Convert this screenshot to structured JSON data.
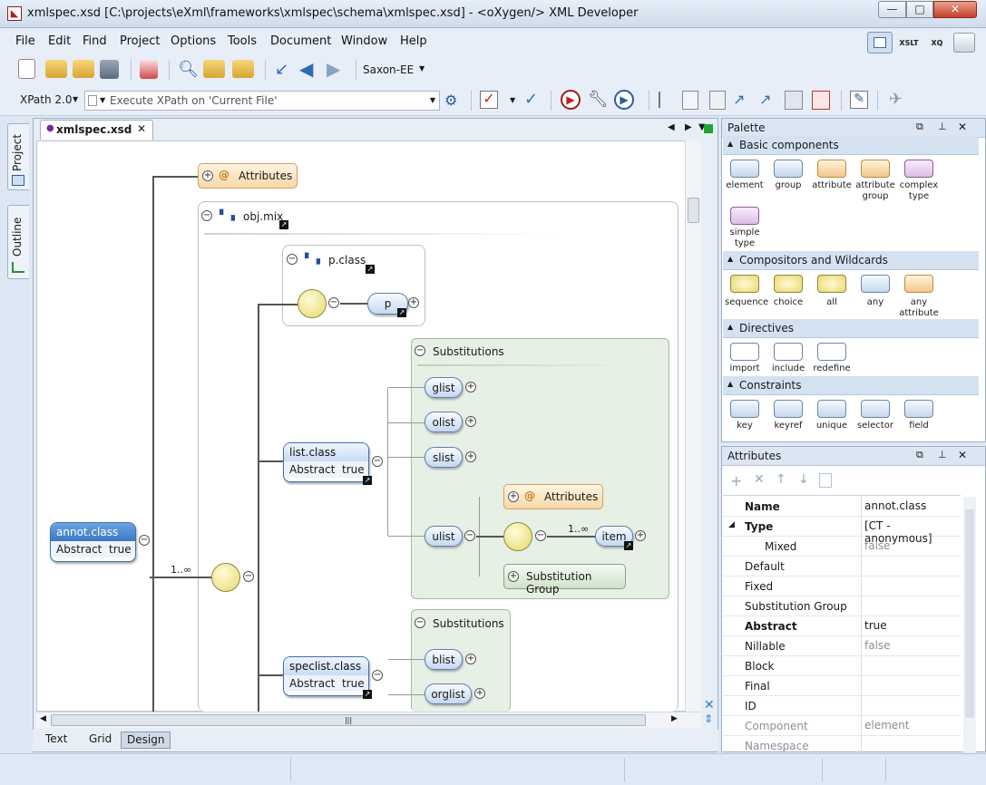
{
  "window": {
    "title": "xmlspec.xsd [C:\\projects\\eXml\\frameworks\\xmlspec\\schema\\xmlspec.xsd] - <oXygen/> XML Developer",
    "minimize": "—",
    "maximize": "□",
    "close": "✕"
  },
  "menu": [
    "File",
    "Edit",
    "Find",
    "Project",
    "Options",
    "Tools",
    "Document",
    "Window",
    "Help"
  ],
  "toolbar": {
    "transformer": "Saxon-EE",
    "xpath_version": "XPath 2.0",
    "xpath_placeholder": "Execute XPath on 'Current File'",
    "badge_xslt": "XSLT",
    "badge_xq": "XQ"
  },
  "side_tabs": [
    "Project",
    "Outline"
  ],
  "editor": {
    "tab_label": "xmlspec.xsd",
    "bottom_tabs": [
      "Text",
      "Grid",
      "Design"
    ],
    "active_bottom_tab": "Design"
  },
  "diagram": {
    "attributes_top": "Attributes",
    "obj_mix": "obj.mix",
    "p_class": "p.class",
    "p": "p",
    "substitutions_1": "Substitutions",
    "glist": "glist",
    "olist": "olist",
    "slist": "slist",
    "ulist": "ulist",
    "list_class": "list.class",
    "list_class_attr": "Abstract",
    "list_class_val": "true",
    "attributes_inner": "Attributes",
    "item": "item",
    "item_card": "1..∞",
    "substitution_group": "Substitution Group",
    "annot_class": "annot.class",
    "annot_attr": "Abstract",
    "annot_val": "true",
    "main_card": "1..∞",
    "substitutions_2": "Substitutions",
    "speclist_class": "speclist.class",
    "speclist_attr": "Abstract",
    "speclist_val": "true",
    "blist": "blist",
    "orglist": "orglist"
  },
  "palette": {
    "title": "Palette",
    "sections": [
      {
        "title": "Basic components",
        "items": [
          "element",
          "group",
          "attribute",
          "attribute\ngroup",
          "complex\ntype",
          "simple\ntype"
        ]
      },
      {
        "title": "Compositors and Wildcards",
        "items": [
          "sequence",
          "choice",
          "all",
          "any",
          "any\nattribute"
        ]
      },
      {
        "title": "Directives",
        "items": [
          "import",
          "include",
          "redefine"
        ]
      },
      {
        "title": "Constraints",
        "items": [
          "key",
          "keyref",
          "unique",
          "selector",
          "field"
        ]
      }
    ]
  },
  "attributes_panel": {
    "title": "Attributes",
    "rows": [
      {
        "name": "Name",
        "value": "annot.class",
        "bold": true,
        "expand": ""
      },
      {
        "name": "Type",
        "value": "[CT - anonymous]",
        "bold": true,
        "expand": "◢"
      },
      {
        "name": "Mixed",
        "value": "false",
        "bold": false,
        "expand": "",
        "indent": true,
        "grey": true
      },
      {
        "name": "Default",
        "value": "",
        "bold": false,
        "expand": ""
      },
      {
        "name": "Fixed",
        "value": "",
        "bold": false,
        "expand": ""
      },
      {
        "name": "Substitution Group",
        "value": "",
        "bold": false,
        "expand": ""
      },
      {
        "name": "Abstract",
        "value": "true",
        "bold": true,
        "expand": ""
      },
      {
        "name": "Nillable",
        "value": "false",
        "bold": false,
        "expand": "",
        "grey": true
      },
      {
        "name": "Block",
        "value": "",
        "bold": false,
        "expand": ""
      },
      {
        "name": "Final",
        "value": "",
        "bold": false,
        "expand": ""
      },
      {
        "name": "ID",
        "value": "",
        "bold": false,
        "expand": ""
      },
      {
        "name": "Component",
        "value": "element",
        "bold": false,
        "expand": "",
        "greyname": true,
        "grey": true
      },
      {
        "name": "Namespace",
        "value": "",
        "bold": false,
        "expand": "",
        "greyname": true
      }
    ]
  }
}
